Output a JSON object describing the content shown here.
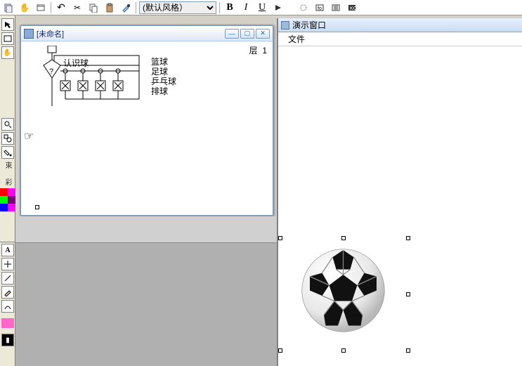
{
  "toolbar": {
    "style_dropdown": "(默认风格）",
    "bold": "B",
    "italic": "I",
    "underline": "U"
  },
  "editor_window": {
    "title": "[未命名]",
    "layer_label": "层",
    "layer_number": "1",
    "flow": {
      "root_label": "认识球",
      "decision": "?"
    },
    "ball_list": [
      "篮球",
      "足球",
      "乒乓球",
      "排球"
    ]
  },
  "demo_window": {
    "title": "演示窗口",
    "menu_file": "文件"
  },
  "left_tools": {
    "constraint_label": "束",
    "color_label": "彩",
    "text_tool": "A"
  },
  "palette_colors": [
    [
      "#ff0000",
      "#ff00ff"
    ],
    [
      "#00ff00",
      "#800080"
    ],
    [
      "#0000ff",
      "#ff00ff"
    ]
  ],
  "palette2": [
    "#ff66cc",
    "#ffffff"
  ],
  "icons": {
    "hand": "✋",
    "scissors": "✂",
    "copy": "⎘",
    "paste": "📋",
    "undo": "↶",
    "pointer": "☞"
  }
}
